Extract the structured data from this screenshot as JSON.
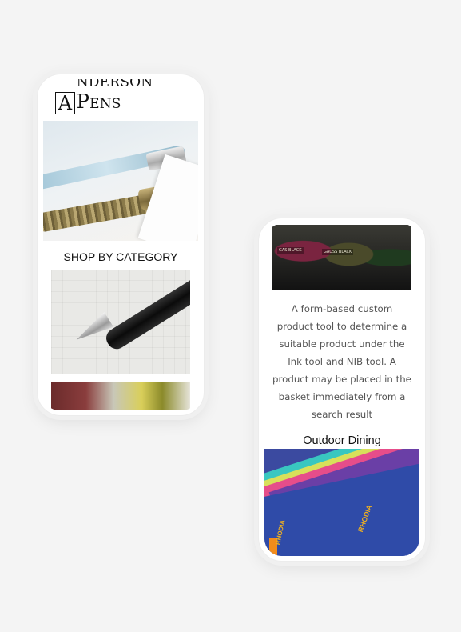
{
  "left_phone": {
    "logo": {
      "initial_a": "A",
      "rest_a": "NDERSON",
      "initial_p": "P",
      "rest_p": "ENS"
    },
    "section_title": "SHOP BY CATEGORY",
    "hero_image": "fountain-pens-photo",
    "category_images": [
      "fountain-pen-nib-photo",
      "ink-bottles-photo"
    ]
  },
  "right_phone": {
    "top_image": "ink-bottles-photo",
    "ink_labels": [
      "GAS BLACK",
      "GAUSS BLACK"
    ],
    "description": "A form-based custom product tool to determine a suitable product under the Ink tool and NIB tool. A product may be placed in the basket immediately from a search result",
    "subtitle": "Outdoor Dining",
    "bottom_image": "notebooks-photo",
    "brand_marks": [
      "RHODIA",
      "RHODIA"
    ]
  },
  "colors": {
    "background": "#f4f4f4",
    "phone": "#ffffff",
    "text_dark": "#111111",
    "text_muted": "#555555"
  }
}
